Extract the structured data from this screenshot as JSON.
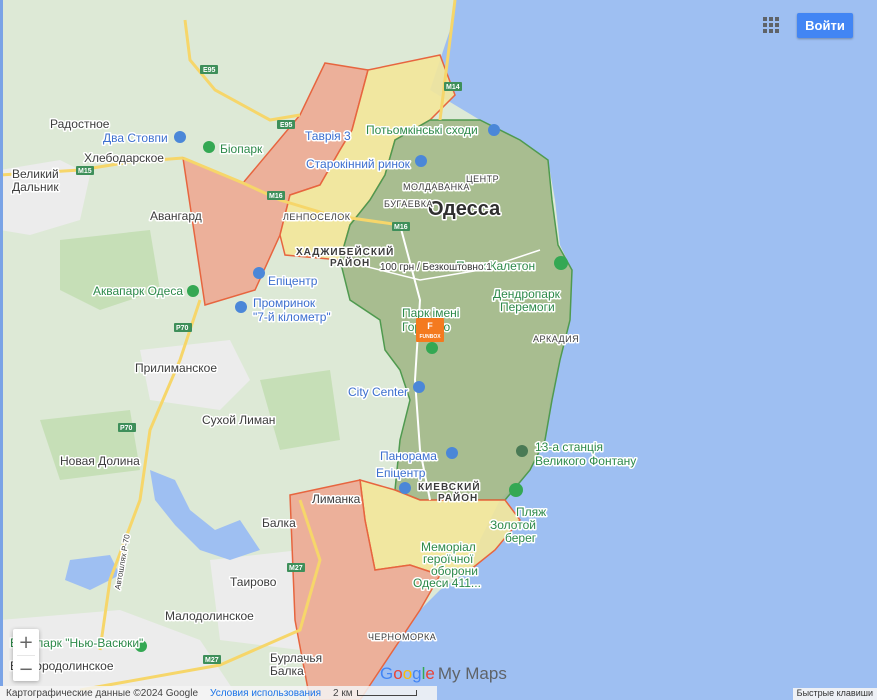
{
  "header": {
    "login_label": "Войти",
    "grid_icon": "apps-grid-icon"
  },
  "colors": {
    "sea": "#9ebff2",
    "land": "#dde9d6",
    "urban": "#ececec",
    "zone_green": "#a3b98a",
    "zone_yellow": "#f3e79a",
    "zone_red": "#eea68f",
    "zone_red_border": "#e7653f",
    "highway": "#f6d66a",
    "accent": "#4285f4"
  },
  "city": {
    "name": "Одесса"
  },
  "places": {
    "radostnoe": "Радостное",
    "hlebodarskoe": "Хлебодарское",
    "velikiy_dalnik": "Великий\nДальник",
    "avangard": "Авангард",
    "prilimanskoe": "Прилиманское",
    "suhoy_liman": "Сухой Лиман",
    "novaya_dolina": "Новая Долина",
    "balka": "Балка",
    "tairovo": "Таирово",
    "malodolinskoe": "Малодолинское",
    "belgorod": "Белгородолинское",
    "limanka": "Лиманка",
    "burlacha": "Бурлачья\nБалка"
  },
  "districts": {
    "hadzhibey": "ХАДЖИБЕЙСКИЙ\nРАЙОН",
    "kievskiy": "КИЕВСКИЙ\nРАЙОН",
    "centr": "ЦЕНТР",
    "moldavanka": "МОЛДАВАНКА",
    "bugaevka": "БУГАЕВКА",
    "lenposelok": "ЛЕНПОСЕЛОК",
    "arkadia": "АРКАДИЯ",
    "chernomorka": "ЧЕРНОМОРКА"
  },
  "pois": {
    "dva_stovpy": "Два Стовпи",
    "biopark": "Біопарк",
    "tavria": "Таврія 3",
    "potomkinski": "Потьомкінські сходи",
    "starokinny": "Старокінний ринок",
    "epicentr_top": "Епіцентр",
    "akvapark": "Аквапарк Одеса",
    "prominok": "Промринок\n\"7-й кілометр\"",
    "park_gorkogo": "Парк імені\nГорького",
    "city_center": "City Center",
    "panorama": "Панорама",
    "epicentr_bottom": "Епіцентр",
    "plyazh_kaleton": "Пляж Калетон",
    "dendropark": "Дендропарк\nПеремоги",
    "stantsia": "13-а станція\nВеликого Фонтану",
    "plyazh_zolotoy": "Пляж\nЗолотой\nберег",
    "memorial": "Меморіал\nгероїчної\nоборони\nОдеси 411...",
    "etnopark": "Етнопарк \"Нью-Васюки\""
  },
  "price_label": "100 грн / Безкоштовно 1",
  "funbox": {
    "brand": "FUNBOX",
    "letter": "F"
  },
  "roads": {
    "e95": "E95",
    "m14": "M14",
    "m15": "M15",
    "m16a": "M16",
    "m16b": "M16",
    "p70a": "P70",
    "p70b": "P70",
    "m27a": "M27",
    "m27b": "M27",
    "avtoshlyakh": "Автошлях Р-70"
  },
  "zoom": {
    "in_label": "+",
    "out_label": "−"
  },
  "brand": {
    "g1": "G",
    "g2": "o",
    "g3": "o",
    "g4": "g",
    "g5": "l",
    "g6": "e",
    "mymaps": "My Maps"
  },
  "footer": {
    "copyright": "Картографические данные ©2024 Google",
    "terms": "Условия использования",
    "scale": "2 км",
    "shortcuts": "Быстрые клавиши"
  }
}
